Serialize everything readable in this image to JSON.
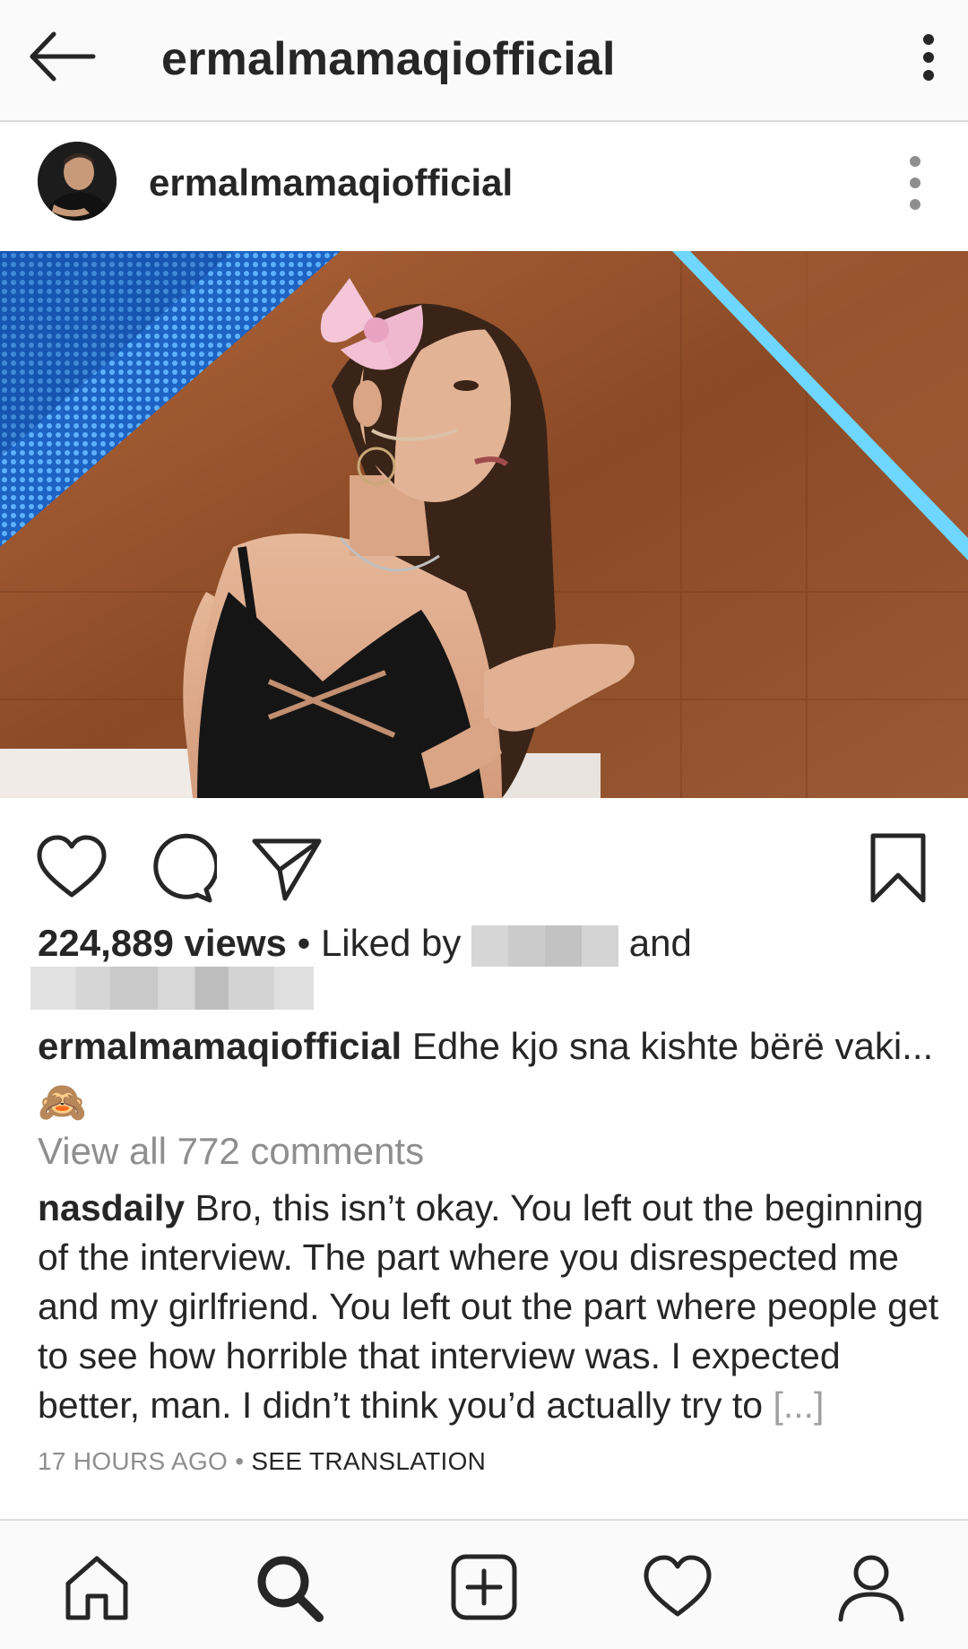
{
  "appbar": {
    "title": "ermalmamaqiofficial",
    "back_icon": "arrow-left-icon",
    "more_icon": "more-vertical-icon"
  },
  "post": {
    "username": "ermalmamaqiofficial",
    "views": "224,889 views",
    "liked_by_prefix": "• Liked by",
    "liked_by_suffix": "and",
    "caption_user": "ermalmamaqiofficial",
    "caption_text": "Edhe kjo sna kishte bërë vaki...",
    "caption_emoji": "🙈",
    "view_all": "View all 772 comments",
    "comment": {
      "user": "nasdaily",
      "text": "Bro, this isn’t okay. You left out the beginning of the interview. The part where you disrespected me and my girlfriend. You left out the part where people get to see how horrible that interview was.  I expected better, man. I didn’t think you’d actually try to",
      "more": "[...]"
    },
    "time": "17 HOURS AGO",
    "separator": "•",
    "see_translation": "SEE TRANSLATION"
  },
  "icons": {
    "like": "heart-icon",
    "comment": "comment-icon",
    "share": "send-icon",
    "save": "bookmark-icon"
  },
  "bottom_nav": [
    "home-icon",
    "search-icon",
    "add-post-icon",
    "activity-heart-icon",
    "profile-icon"
  ],
  "colors": {
    "text": "#262626",
    "muted": "#8e8e8e",
    "divider": "#dbdbdb",
    "background": "#fafafa"
  }
}
